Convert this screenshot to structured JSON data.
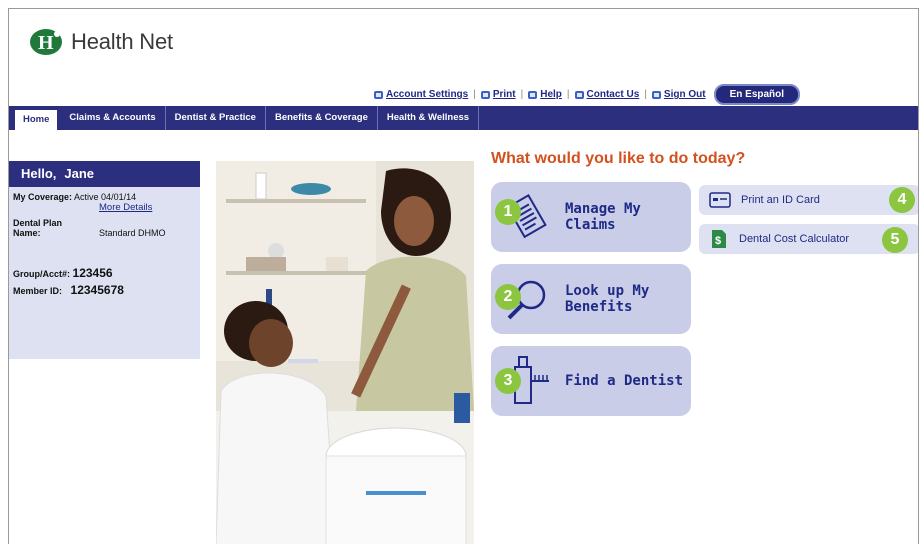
{
  "brand": {
    "name": "Health Net",
    "mark": "H"
  },
  "utility_links": [
    "Account Settings",
    "Print",
    "Help",
    "Contact Us",
    "Sign Out"
  ],
  "espanol_label": "En Español",
  "nav": [
    "Home",
    "Claims & Accounts",
    "Dentist & Practice",
    "Benefits & Coverage",
    "Health & Wellness"
  ],
  "sidebar": {
    "greeting": "Hello,",
    "user": "Jane",
    "coverage_label": "My Coverage:",
    "coverage_value": "Active 04/01/14",
    "more_details": "More Details",
    "plan_label_1": "Dental Plan",
    "plan_label_2": "Name:",
    "plan_value": "Standard DHMO",
    "group_label": "Group/Acct#:",
    "group_value": "123456",
    "member_label": "Member ID:",
    "member_value": "12345678"
  },
  "headline": "What would you like to do today?",
  "actions": [
    {
      "num": "1",
      "line1": "Manage My",
      "line2": "Claims",
      "icon": "document-icon"
    },
    {
      "num": "2",
      "line1": "Look up My",
      "line2": "Benefits",
      "icon": "magnifier-icon"
    },
    {
      "num": "3",
      "line1": "Find a Dentist",
      "line2": "",
      "icon": "toothbrush-icon"
    }
  ],
  "quick_actions": [
    {
      "num": "4",
      "label": "Print an ID Card",
      "icon": "id-card-icon"
    },
    {
      "num": "5",
      "label": "Dental Cost Calculator",
      "icon": "dollar-icon"
    }
  ],
  "colors": {
    "navy": "#2b2f7e",
    "orange": "#d2521e",
    "green": "#8cc53f",
    "card": "#c9cde7"
  }
}
